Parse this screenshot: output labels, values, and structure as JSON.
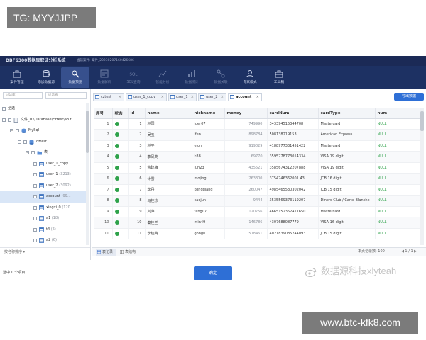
{
  "overlay_tag": "TG: MYYJJPP",
  "overlay_url": "www.btc-kfk8.com",
  "watermark": "数据源科技xlyteah",
  "titlebar": {
    "app_title": "DBF6300数据库取证分析系统",
    "sub_info": "当前案件: 案件_20230207160426686"
  },
  "toolbar": [
    {
      "label": "案件管理",
      "icon": "briefcase-icon",
      "active": false,
      "dim": false
    },
    {
      "label": "添加数据源",
      "icon": "add-datasource-icon",
      "active": false,
      "dim": false
    },
    {
      "label": "数据预览",
      "icon": "data-preview-icon",
      "active": true,
      "dim": false
    },
    {
      "label": "数据解析",
      "icon": "data-parse-icon",
      "active": false,
      "dim": true
    },
    {
      "label": "SQL查询",
      "icon": "sql-icon",
      "active": false,
      "dim": true
    },
    {
      "label": "智能分析",
      "icon": "analysis-icon",
      "active": false,
      "dim": true
    },
    {
      "label": "数据统计",
      "icon": "statistics-icon",
      "active": false,
      "dim": true
    },
    {
      "label": "数据关联",
      "icon": "relation-icon",
      "active": false,
      "dim": true
    },
    {
      "label": "专家模式",
      "icon": "expert-icon",
      "active": false,
      "dim": false
    },
    {
      "label": "工具箱",
      "icon": "toolbox-icon",
      "active": false,
      "dim": false
    }
  ],
  "left_pane": {
    "search1_placeholder": "过滤库",
    "search2_placeholder": "过滤表",
    "bottom_label": "按名称排序 ▾",
    "tree": [
      {
        "label": "全选",
        "level": 0,
        "toggle": "",
        "icon": ""
      },
      {
        "label": "文件_D:\\Database\\cztest\\a3.f...",
        "level": 0,
        "toggle": "−",
        "icon": "file"
      },
      {
        "label": "MySql",
        "level": 1,
        "toggle": "−",
        "icon": "db"
      },
      {
        "label": "cztest",
        "level": 2,
        "toggle": "−",
        "icon": "db"
      },
      {
        "label": "表",
        "level": 3,
        "toggle": "−",
        "icon": "folder"
      },
      {
        "label": "user_1_copy...",
        "count": "",
        "level": 4,
        "icon": "table"
      },
      {
        "label": "user_1",
        "count": "(3213)",
        "level": 4,
        "icon": "table"
      },
      {
        "label": "user_2",
        "count": "(3092)",
        "level": 4,
        "icon": "table"
      },
      {
        "label": "account",
        "count": "(99...",
        "level": 4,
        "icon": "table",
        "selected": true
      },
      {
        "label": "xingxi_0",
        "count": "(120...",
        "level": 4,
        "icon": "table"
      },
      {
        "label": "a1",
        "count": "(18)",
        "level": 4,
        "icon": "table"
      },
      {
        "label": "t4",
        "count": "(6)",
        "level": 4,
        "icon": "table"
      },
      {
        "label": "a2",
        "count": "(6)",
        "level": 4,
        "icon": "table"
      }
    ]
  },
  "tabs": [
    {
      "label": "cztest",
      "active": false
    },
    {
      "label": "user_1_copy",
      "active": false
    },
    {
      "label": "user_1",
      "active": false
    },
    {
      "label": "user_2",
      "active": false
    },
    {
      "label": "account",
      "active": true
    }
  ],
  "export_label": "导出数据",
  "table": {
    "columns": [
      "序号",
      "状态",
      "id",
      "name",
      "nickname",
      "money",
      "cardNum",
      "cardType",
      "num"
    ],
    "rows": [
      [
        "1",
        "ok",
        "1",
        "赵国",
        "juer07",
        "749990",
        "343394515344708",
        "Mastercard",
        "NULL"
      ],
      [
        "2",
        "ok",
        "2",
        "吴玉",
        "lfen",
        "898784",
        "508138219153",
        "American Express",
        "NULL"
      ],
      [
        "3",
        "ok",
        "3",
        "赵平",
        "eion",
        "919029",
        "4188977331451422",
        "Mastercard",
        "NULL"
      ],
      [
        "4",
        "ok",
        "4",
        "李凤英",
        "k88",
        "69770",
        "3595278773014334",
        "VISA 19 digit",
        "NULL"
      ],
      [
        "5",
        "ok",
        "5",
        "余建梅",
        "jun23",
        "435521",
        "3585674312207888",
        "VISA 19 digit",
        "NULL"
      ],
      [
        "6",
        "ok",
        "6",
        "计雪",
        "mojing",
        "263300",
        "3754746362001 43",
        "JCB 16 digit",
        "NULL"
      ],
      [
        "7",
        "ok",
        "7",
        "李丹",
        "kongqiang",
        "260047",
        "4985465530302042",
        "JCB 15 digit",
        "NULL"
      ],
      [
        "8",
        "ok",
        "8",
        "马桂珍",
        "caojun",
        "9444",
        "3535569373119207",
        "Diners Club / Carte Blanche",
        "NULL"
      ],
      [
        "9",
        "ok",
        "9",
        "刘萍",
        "fang07",
        "120756",
        "4665152352417650",
        "Mastercard",
        "NULL"
      ],
      [
        "10",
        "ok",
        "10",
        "秦桂兰",
        "min49",
        "146786",
        "4307688087779",
        "VISA 16 digit",
        "NULL"
      ],
      [
        "11",
        "ok",
        "11",
        "李桂英",
        "gongli",
        "518461",
        "4021839085244093",
        "JCB 15 digit",
        "NULL"
      ]
    ]
  },
  "statusbar": {
    "tab_records": "表记录",
    "tab_structure": "表结构",
    "summary": "本页记录数: 100",
    "pager": "◀ 1 / 1 ▶"
  },
  "footer": {
    "selected_count": "选中 0 个项目",
    "confirm_label": "确定"
  }
}
